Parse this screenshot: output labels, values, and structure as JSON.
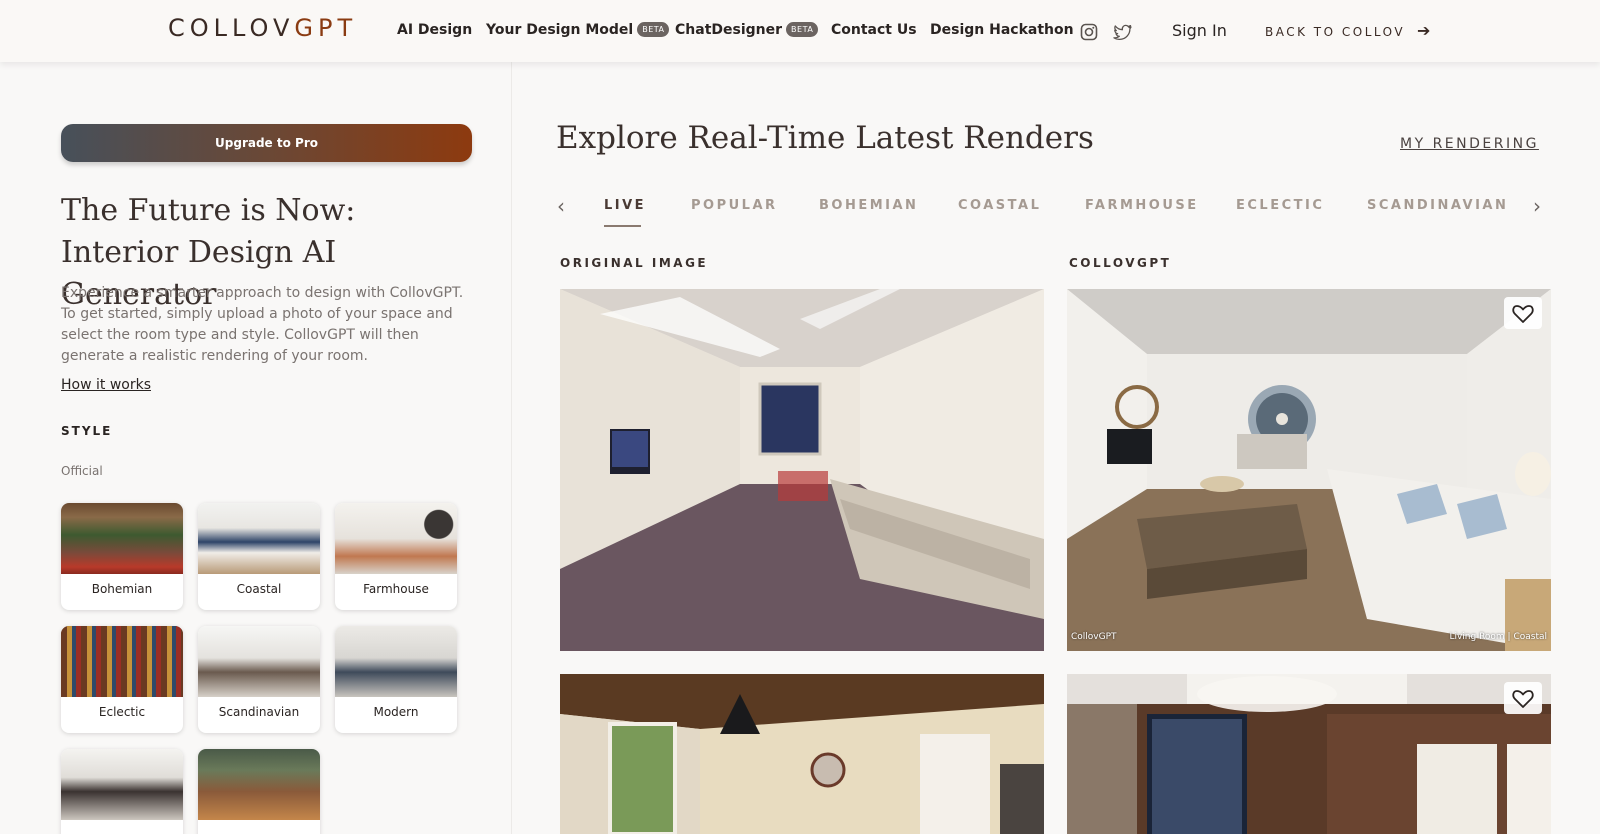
{
  "header": {
    "logo_a": "COLLOV",
    "logo_b": "GPT",
    "nav": [
      {
        "label": "AI Design"
      },
      {
        "label": "Your Design Model",
        "badge": "BETA"
      },
      {
        "label": "ChatDesigner",
        "badge": "BETA"
      },
      {
        "label": "Contact Us"
      },
      {
        "label": "Design Hackathon"
      }
    ],
    "social": [
      "instagram-icon",
      "twitter-icon"
    ],
    "signin": "Sign In",
    "back": "BACK TO COLLOV"
  },
  "sidebar": {
    "upgrade": "Upgrade to Pro",
    "title_line1": "The Future is Now:",
    "title_line2": "Interior Design AI Generator",
    "description": "Experience a smarter approach to design with CollovGPT. To get started, simply upload a photo of your space and select the room type and style. CollovGPT will then generate a realistic rendering of your room.",
    "how": "How it works",
    "style_heading": "STYLE",
    "official": "Official",
    "styles": [
      {
        "label": "Bohemian"
      },
      {
        "label": "Coastal"
      },
      {
        "label": "Farmhouse"
      },
      {
        "label": "Eclectic"
      },
      {
        "label": "Scandinavian"
      },
      {
        "label": "Modern"
      }
    ]
  },
  "main": {
    "title": "Explore Real-Time Latest Renders",
    "my_rendering": "MY RENDERING",
    "tabs": [
      "LIVE",
      "POPULAR",
      "BOHEMIAN",
      "COASTAL",
      "FARMHOUSE",
      "ECLECTIC",
      "SCANDINAVIAN"
    ],
    "active_tab": "LIVE",
    "original_heading": "ORIGINAL IMAGE",
    "collov_heading": "COLLOVGPT",
    "caption_left": "CollovGPT",
    "caption_right": "Living Room | Coastal"
  },
  "colors": {
    "accent": "#8d3a0f",
    "gradient_start": "#47505a",
    "text_dark": "#2a2422",
    "tab_inactive": "#a59a92"
  }
}
